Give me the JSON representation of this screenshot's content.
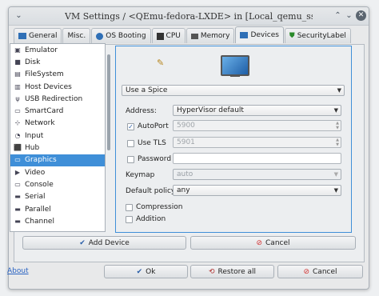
{
  "window": {
    "title": "VM Settings / <QEmu-fedora-LXDE> in [Local_qemu_ssh]",
    "menu_icon": "chevron-down-icon",
    "controls": [
      "up-icon",
      "down-icon",
      "close-icon"
    ]
  },
  "tabs": [
    {
      "label": "General",
      "icon": "general-icon"
    },
    {
      "label": "Misc.",
      "icon": "misc-icon"
    },
    {
      "label": "OS Booting",
      "icon": "disc-icon"
    },
    {
      "label": "CPU",
      "icon": "cpu-icon"
    },
    {
      "label": "Memory",
      "icon": "memory-icon"
    },
    {
      "label": "Devices",
      "icon": "devices-icon"
    },
    {
      "label": "SecurityLabel",
      "icon": "shield-icon"
    }
  ],
  "device_list": [
    {
      "label": "Emulator"
    },
    {
      "label": "Disk"
    },
    {
      "label": "FileSystem"
    },
    {
      "label": "Host Devices"
    },
    {
      "label": "USB Redirection"
    },
    {
      "label": "SmartCard"
    },
    {
      "label": "Network"
    },
    {
      "label": "Input"
    },
    {
      "label": "Hub"
    },
    {
      "label": "Graphics"
    },
    {
      "label": "Video"
    },
    {
      "label": "Console"
    },
    {
      "label": "Serial"
    },
    {
      "label": "Parallel"
    },
    {
      "label": "Channel"
    }
  ],
  "graphics": {
    "type": "Use a Spice",
    "address_label": "Address:",
    "address_value": "HyperVisor default",
    "autoport_label": "AutoPort",
    "autoport_value": "5900",
    "autoport_checked": true,
    "tls_label": "Use TLS",
    "tls_value": "5901",
    "tls_checked": false,
    "password_label": "Password",
    "password_checked": false,
    "keymap_label": "Keymap",
    "keymap_value": "auto",
    "policy_label": "Default policy",
    "policy_value": "any",
    "compression_label": "Compression",
    "addition_label": "Addition"
  },
  "device_buttons": {
    "add": "Add Device",
    "cancel": "Cancel"
  },
  "footer": {
    "about": "About",
    "ok": "Ok",
    "restore": "Restore all",
    "cancel": "Cancel"
  },
  "colors": {
    "selection": "#3f8fd8",
    "link": "#2a63c2",
    "ok_check": "#2a5ea8",
    "cancel_red": "#d23030"
  }
}
